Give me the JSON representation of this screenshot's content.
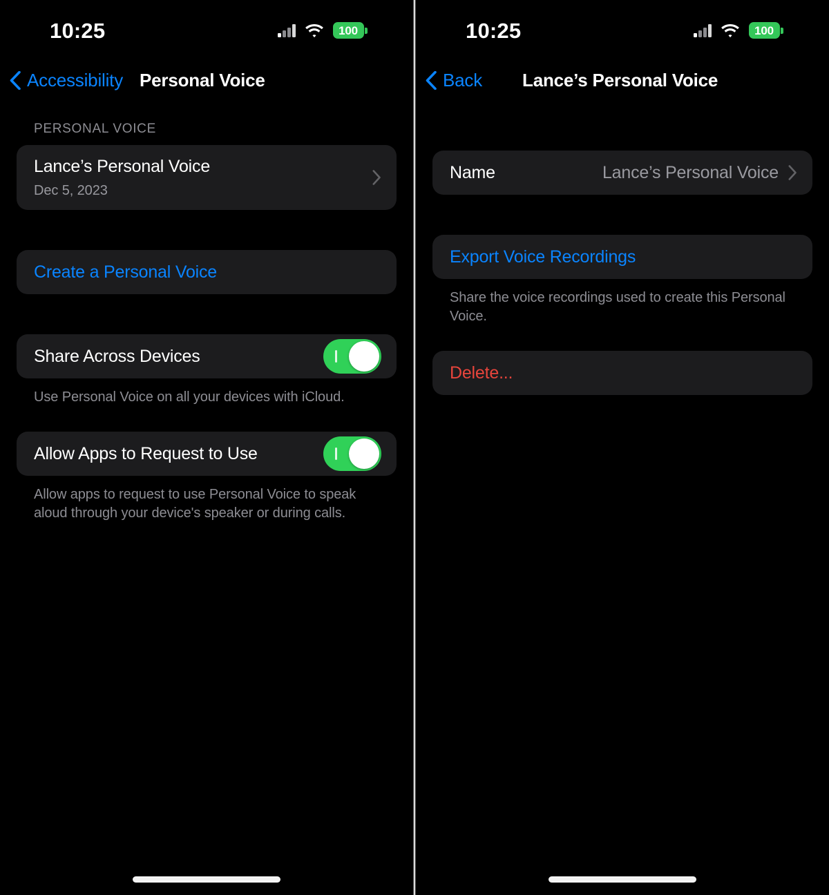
{
  "status_bar": {
    "time": "10:25",
    "battery_percent": "100",
    "signal_icon": "cellular-bars-icon",
    "wifi_icon": "wifi-icon",
    "battery_icon": "battery-icon"
  },
  "colors": {
    "accent_blue": "#0a84ff",
    "destructive_red": "#e8453c",
    "toggle_green": "#30d158",
    "battery_green": "#34c759",
    "card_background": "#1c1c1e",
    "page_background": "#000000",
    "secondary_text": "#8d8d93"
  },
  "left_screen": {
    "nav": {
      "back_label": "Accessibility",
      "title": "Personal Voice"
    },
    "section_header": "PERSONAL VOICE",
    "voice_item": {
      "title": "Lance’s Personal Voice",
      "subtitle": "Dec 5, 2023",
      "chevron": "chevron-right-icon"
    },
    "create_action": "Create a Personal Voice",
    "toggles": [
      {
        "label": "Share Across Devices",
        "state": "on",
        "footnote": "Use Personal Voice on all your devices with iCloud."
      },
      {
        "label": "Allow Apps to Request to Use",
        "state": "on",
        "footnote": "Allow apps to request to use Personal Voice to speak aloud through your device's speaker or during calls."
      }
    ]
  },
  "right_screen": {
    "nav": {
      "back_label": "Back",
      "title": "Lance’s Personal Voice"
    },
    "name_row": {
      "label": "Name",
      "value": "Lance’s Personal Voice",
      "chevron": "chevron-right-icon"
    },
    "export": {
      "action": "Export Voice Recordings",
      "footnote": "Share the voice recordings used to create this Personal Voice."
    },
    "delete": {
      "action": "Delete..."
    }
  }
}
